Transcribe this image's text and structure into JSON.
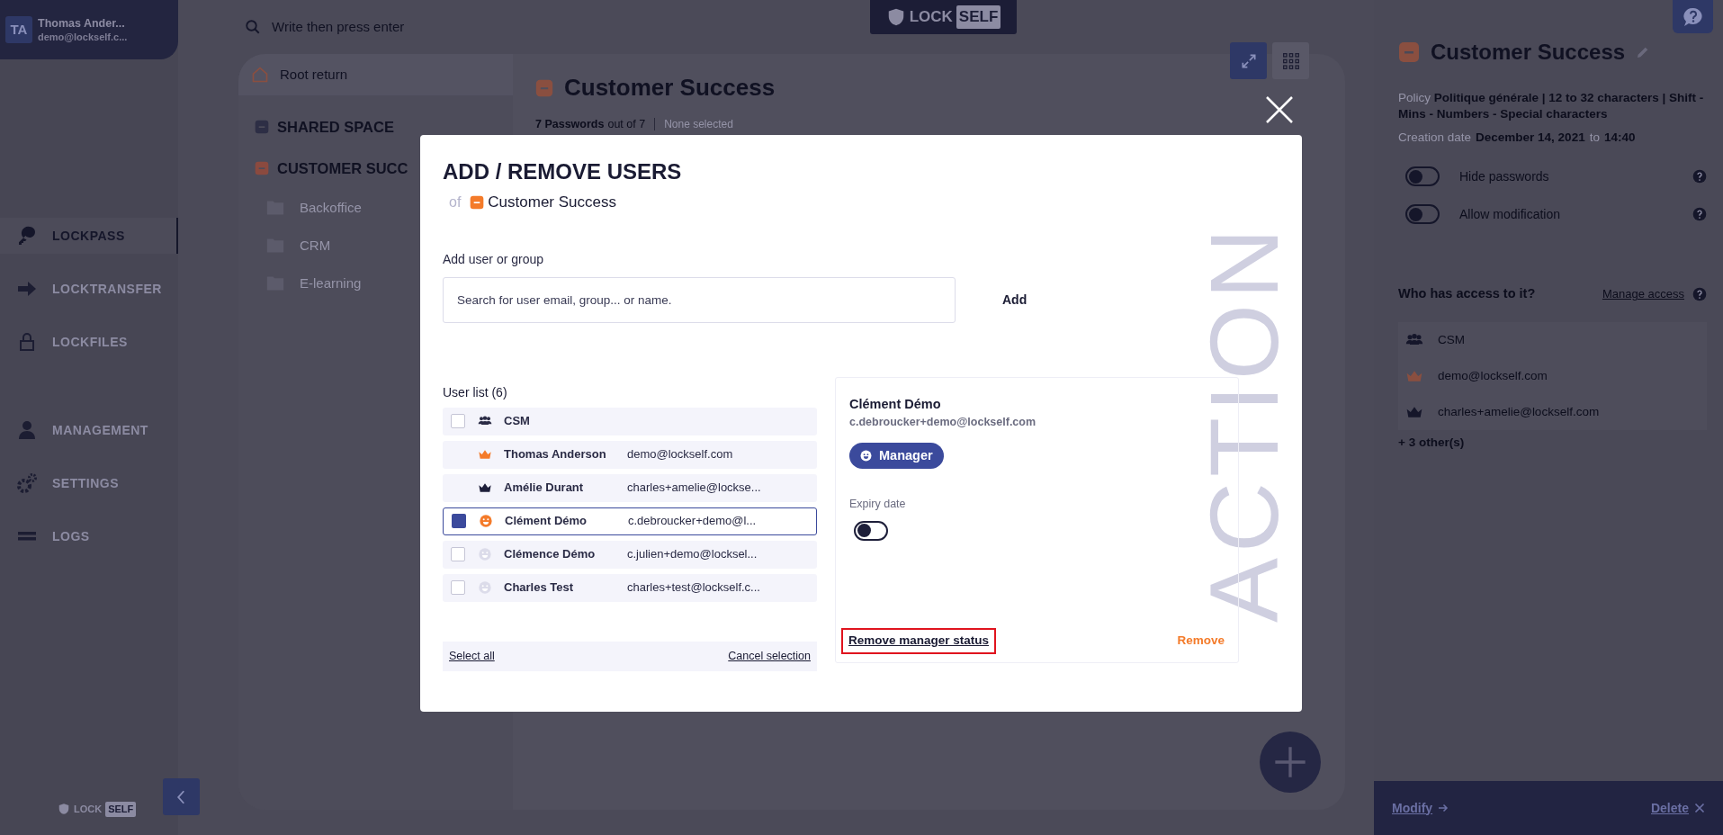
{
  "user": {
    "initials": "TA",
    "name": "Thomas Ander...",
    "email": "demo@lockself.c..."
  },
  "nav": [
    {
      "items": [
        {
          "kind": "key",
          "label": "LOCKPASS",
          "selected": true
        },
        {
          "kind": "arrow",
          "label": "LOCKTRANSFER",
          "selected": false
        },
        {
          "kind": "lock",
          "label": "LOCKFILES",
          "selected": false
        }
      ]
    },
    {
      "items": [
        {
          "kind": "person",
          "label": "MANAGEMENT",
          "selected": false
        },
        {
          "kind": "gears",
          "label": "SETTINGS",
          "selected": false
        },
        {
          "kind": "bars",
          "label": "LOGS",
          "selected": false
        }
      ]
    }
  ],
  "sidebar_logo": {
    "left": "LOCK",
    "right": "SELF"
  },
  "search": {
    "placeholder": "Write then press enter"
  },
  "header_logo": {
    "left": "LOCK",
    "right": "SELF"
  },
  "tree": {
    "root": "Root return",
    "spaces": [
      {
        "label": "SHARED SPACE",
        "color": "#2d2e45"
      },
      {
        "label": "CUSTOMER SUCC",
        "color": "#8b4a3f",
        "children": [
          {
            "label": "Backoffice"
          },
          {
            "label": "CRM"
          },
          {
            "label": "E-learning"
          }
        ]
      }
    ]
  },
  "content": {
    "title": "Customer Success",
    "count": "7 Passwords",
    "count_suffix": "out of 7",
    "selection": "None selected"
  },
  "view_buttons": [
    {
      "kind": "expand",
      "selected": true
    },
    {
      "kind": "grid",
      "selected": false
    }
  ],
  "modal": {
    "title": "ADD / REMOVE USERS",
    "of": "of",
    "target": "Customer Success",
    "search_label": "Add user or group",
    "search_placeholder": "Search for user email, group... or name.",
    "add_button": "Add",
    "list_title": "User list (6)",
    "users": [
      {
        "kind": "group",
        "name": "CSM",
        "selectable": true,
        "checked": false,
        "selected": false
      },
      {
        "kind": "owner",
        "name": "Thomas Anderson",
        "email": "demo@lockself.com",
        "selectable": false,
        "selected": false
      },
      {
        "kind": "admin",
        "name": "Amélie Durant",
        "email": "charles+amelie@lockse...",
        "selectable": false,
        "selected": false
      },
      {
        "kind": "manager",
        "name": "Clément Démo",
        "email": "c.debroucker+demo@l...",
        "selectable": true,
        "checked": true,
        "selected": true
      },
      {
        "kind": "member",
        "name": "Clémence Démo",
        "email": "c.julien+demo@locksel...",
        "selectable": true,
        "checked": false,
        "selected": false
      },
      {
        "kind": "member",
        "name": "Charles Test",
        "email": "charles+test@lockself.c...",
        "selectable": true,
        "checked": false,
        "selected": false
      }
    ],
    "select_all": "Select all",
    "cancel_selection": "Cancel selection",
    "detail": {
      "name": "Clément Démo",
      "email": "c.debroucker+demo@lockself.com",
      "role_badge": "Manager",
      "expiry_label": "Expiry date",
      "expiry_on": false,
      "remove_manager": "Remove manager status",
      "highlighted": true,
      "remove": "Remove"
    },
    "watermark": "ACTION"
  },
  "details": {
    "title": "Customer Success",
    "policy_label": "Policy",
    "policy_value": "Politique générale | 12 to 32 characters | Shift - Mins - Numbers - Special characters",
    "creation_label": "Creation date",
    "creation_date": "December 14, 2021",
    "creation_to": "to",
    "creation_time": "14:40",
    "toggles": [
      {
        "label": "Hide passwords",
        "on": false
      },
      {
        "label": "Allow modification",
        "on": false
      }
    ],
    "access_title": "Who has access to it?",
    "manage_access": "Manage access",
    "access": [
      {
        "kind": "group",
        "label": "CSM"
      },
      {
        "kind": "owner",
        "label": "demo@lockself.com"
      },
      {
        "kind": "admin",
        "label": "charles+amelie@lockself.com"
      }
    ],
    "others": "+ 3 other(s)"
  },
  "footer": {
    "modify": "Modify",
    "delete": "Delete"
  }
}
